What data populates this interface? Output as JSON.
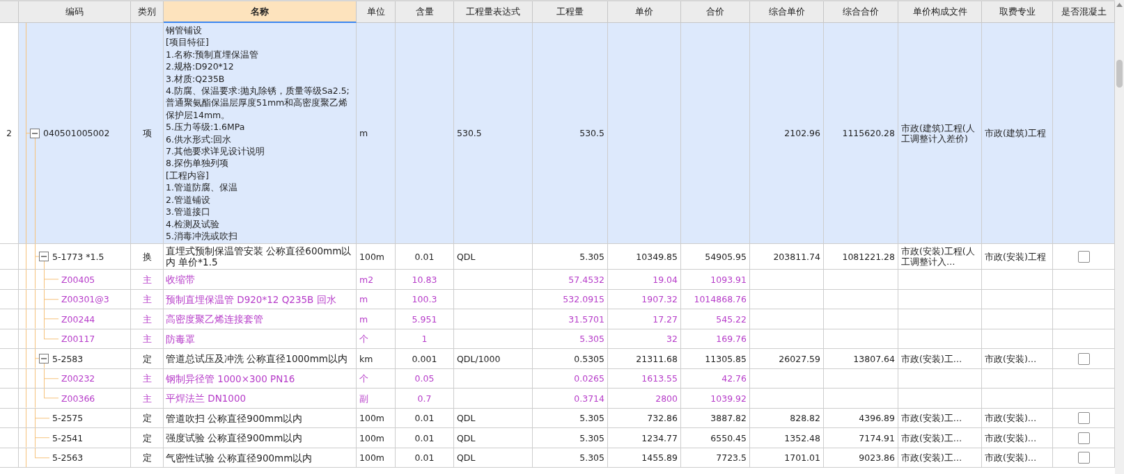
{
  "columns": [
    {
      "label": "编码",
      "selected": false
    },
    {
      "label": "类别",
      "selected": false
    },
    {
      "label": "名称",
      "selected": true
    },
    {
      "label": "单位",
      "selected": false
    },
    {
      "label": "含量",
      "selected": false
    },
    {
      "label": "工程量表达式",
      "selected": false
    },
    {
      "label": "工程量",
      "selected": false
    },
    {
      "label": "单价",
      "selected": false
    },
    {
      "label": "合价",
      "selected": false
    },
    {
      "label": "综合单价",
      "selected": false
    },
    {
      "label": "综合合价",
      "selected": false
    },
    {
      "label": "单价构成文件",
      "selected": false
    },
    {
      "label": "取费专业",
      "selected": false
    },
    {
      "label": "是否混凝土",
      "selected": false
    }
  ],
  "rows": [
    {
      "row_number": "2",
      "kind": "work",
      "selected": true,
      "expanded": true,
      "code": "040501005002",
      "type": "项",
      "name": "钢管铺设\n[项目特征]\n1.名称:预制直埋保温管\n2.规格:D920*12\n3.材质:Q235B\n4.防腐、保温要求:抛丸除锈，质量等级Sa2.5;普通聚氨酯保温层厚度51mm和高密度聚乙烯保护层14mm。\n5.压力等级:1.6MPa\n6.供水形式:回水\n7.其他要求详见设计说明\n8.探伤单独列项\n[工程内容]\n1.管道防腐、保温\n2.管道铺设\n3.管道接口\n4.检测及试验\n5.消毒冲洗或吹扫",
      "unit": "m",
      "expr": "530.5",
      "qty": "530.5",
      "comp_price": "2102.96",
      "comp_total": "1115620.28",
      "price_file": "市政(建筑)工程(人工调整计入差价)",
      "fee_specialty": "市政(建筑)工程",
      "children": [
        {
          "kind": "work",
          "selected": false,
          "expanded": true,
          "code": "5-1773 *1.5",
          "type": "换",
          "name": "直埋式预制保温管安装 公称直径600mm以内 单价*1.5",
          "unit": "100m",
          "content": "0.01",
          "expr": "QDL",
          "qty": "5.305",
          "price": "10349.85",
          "total": "54905.95",
          "comp_price": "203811.74",
          "comp_total": "1081221.28",
          "price_file": "市政(安装)工程(人工调整计入…",
          "fee_specialty": "市政(安装)工程",
          "concrete_checked": false,
          "children": [
            {
              "kind": "material",
              "selected": false,
              "code": "Z00405",
              "type": "主",
              "name": "收缩带",
              "unit": "m2",
              "content": "10.83",
              "qty": "57.4532",
              "price": "19.04",
              "total": "1093.91"
            },
            {
              "kind": "material",
              "selected": false,
              "code": "Z00301@3",
              "type": "主",
              "name": "预制直埋保温管 D920*12 Q235B 回水",
              "unit": "m",
              "content": "100.3",
              "qty": "532.0915",
              "price": "1907.32",
              "total": "1014868.76"
            },
            {
              "kind": "material",
              "selected": false,
              "code": "Z00244",
              "type": "主",
              "name": "高密度聚乙烯连接套管",
              "unit": "m",
              "content": "5.951",
              "qty": "31.5701",
              "price": "17.27",
              "total": "545.22"
            },
            {
              "kind": "material",
              "selected": false,
              "code": "Z00117",
              "type": "主",
              "name": "防毒罩",
              "unit": "个",
              "content": "1",
              "qty": "5.305",
              "price": "32",
              "total": "169.76"
            }
          ]
        },
        {
          "kind": "work",
          "selected": false,
          "expanded": true,
          "code": "5-2583",
          "type": "定",
          "name": "管道总试压及冲洗 公称直径1000mm以内",
          "unit": "km",
          "content": "0.001",
          "expr": "QDL/1000",
          "qty": "0.5305",
          "price": "21311.68",
          "total": "11305.85",
          "comp_price": "26027.59",
          "comp_total": "13807.64",
          "price_file": "市政(安装)工…",
          "fee_specialty": "市政(安装)…",
          "concrete_checked": false,
          "children": [
            {
              "kind": "material",
              "selected": false,
              "code": "Z00232",
              "type": "主",
              "name": "钢制异径管 1000×300 PN16",
              "unit": "个",
              "content": "0.05",
              "qty": "0.0265",
              "price": "1613.55",
              "total": "42.76"
            },
            {
              "kind": "material",
              "selected": false,
              "code": "Z00366",
              "type": "主",
              "name": "平焊法兰 DN1000",
              "unit": "副",
              "content": "0.7",
              "qty": "0.3714",
              "price": "2800",
              "total": "1039.92"
            }
          ]
        },
        {
          "kind": "work",
          "selected": false,
          "code": "5-2575",
          "type": "定",
          "name": "管道吹扫 公称直径900mm以内",
          "unit": "100m",
          "content": "0.01",
          "expr": "QDL",
          "qty": "5.305",
          "price": "732.86",
          "total": "3887.82",
          "comp_price": "828.82",
          "comp_total": "4396.89",
          "price_file": "市政(安装)工…",
          "fee_specialty": "市政(安装)…",
          "concrete_checked": false
        },
        {
          "kind": "work",
          "selected": false,
          "code": "5-2541",
          "type": "定",
          "name": "强度试验 公称直径900mm以内",
          "unit": "100m",
          "content": "0.01",
          "expr": "QDL",
          "qty": "5.305",
          "price": "1234.77",
          "total": "6550.45",
          "comp_price": "1352.48",
          "comp_total": "7174.91",
          "price_file": "市政(安装)工…",
          "fee_specialty": "市政(安装)…",
          "concrete_checked": false
        },
        {
          "kind": "work",
          "selected": false,
          "code": "5-2563",
          "type": "定",
          "name": "气密性试验 公称直径900mm以内",
          "unit": "100m",
          "content": "0.01",
          "expr": "QDL",
          "qty": "5.305",
          "price": "1455.89",
          "total": "7723.5",
          "comp_price": "1701.01",
          "comp_total": "9023.86",
          "price_file": "市政(安装)工…",
          "fee_specialty": "市政(安装)…",
          "concrete_checked": false
        }
      ]
    }
  ]
}
